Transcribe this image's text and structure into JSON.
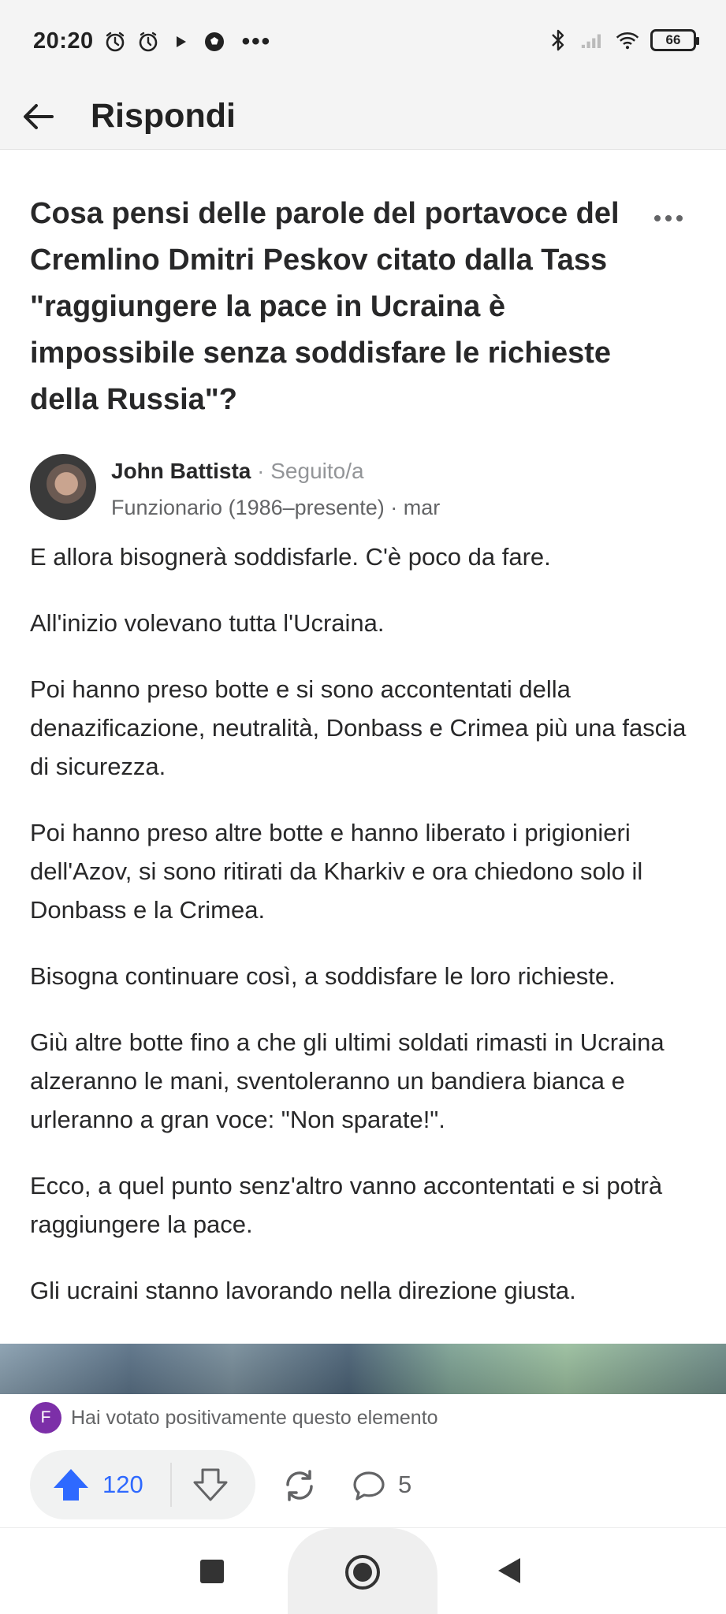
{
  "status_bar": {
    "time": "20:20",
    "icons_left": [
      "alarm-icon",
      "clock-icon",
      "play-icon",
      "soccer-ball-icon"
    ],
    "more": "•••",
    "icons_right": [
      "bluetooth-icon",
      "signal-icon",
      "wifi-icon"
    ],
    "battery": "66"
  },
  "appbar": {
    "title": "Rispondi"
  },
  "question": {
    "text": "Cosa pensi delle parole del portavoce del Cremlino Dmitri Peskov citato dalla Tass \"raggiungere la pace in Ucraina è impossibile senza soddisfare le richieste della Russia\"?"
  },
  "author": {
    "name": "John Battista",
    "separator": "·",
    "follow_status": "Seguito/a",
    "credential": "Funzionario (1986–presente) · mar"
  },
  "answer": {
    "paragraphs": [
      "E allora bisognerà soddisfarle. C'è poco da fare.",
      "All'inizio volevano tutta l'Ucraina.",
      "Poi hanno preso botte e si sono accontentati della denazificazione, neutralità, Donbass e Crimea più una fascia di sicurezza.",
      "Poi hanno preso altre botte e hanno liberato i prigionieri dell'Azov, si sono ritirati da Kharkiv e ora chiedono solo il Donbass e la Crimea.",
      "Bisogna continuare così, a soddisfare le loro richieste.",
      "Giù altre botte fino a che gli ultimi soldati rimasti in Ucraina alzeranno le mani, sventoleranno un bandiera bianca e urleranno a gran voce: \"Non sparate!\".",
      "Ecco, a quel punto senz'altro vanno accontentati e si potrà raggiungere la pace.",
      "Gli ucraini stanno lavorando nella direzione giusta."
    ]
  },
  "upvote_notice": {
    "avatar_letter": "F",
    "text": "Hai votato positivamente questo elemento"
  },
  "actions": {
    "upvotes": "120",
    "comments": "5",
    "accent_color": "#2e69ff"
  }
}
